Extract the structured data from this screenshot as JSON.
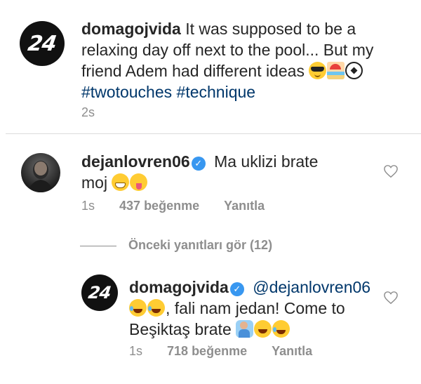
{
  "post": {
    "avatar_text": "24",
    "username": "domagojvida",
    "caption": "It was supposed to be a relaxing day off next to the pool... But my friend Adem had different ideas",
    "caption_emojis": [
      "smiling-face-with-sunglasses",
      "beach-with-umbrella",
      "soccer-ball"
    ],
    "hashtags": [
      "#twotouches",
      "#technique"
    ],
    "time": "2s"
  },
  "comments": [
    {
      "username": "dejanlovren06",
      "verified": true,
      "text_part1": "Ma uklizi brate",
      "text_part2": "moj",
      "emojis": [
        "grinning-face",
        "squinting-face-with-tongue"
      ],
      "time": "1s",
      "likes": "437 beğenme",
      "reply_label": "Yanıtla"
    },
    {
      "username": "domagojvida",
      "verified": true,
      "avatar_text": "24",
      "mention": "@dejanlovren06",
      "text_part1": ", fali nam jedan! Come to",
      "text_part2": "Beşiktaş brate",
      "emojis_line1": [
        "face-with-tears-of-joy",
        "face-with-tears-of-joy"
      ],
      "emojis_line2": [
        "person-raising-hand",
        "grinning-face-with-big-eyes",
        "face-with-tears-of-joy"
      ],
      "time": "1s",
      "likes": "718 beğenme",
      "reply_label": "Yanıtla"
    }
  ],
  "view_replies": "Önceki yanıtları gör (12)",
  "colors": {
    "link": "#00376b",
    "verified": "#3897f0",
    "secondary_text": "#8e8e8e",
    "divider": "#dbdbdb"
  }
}
